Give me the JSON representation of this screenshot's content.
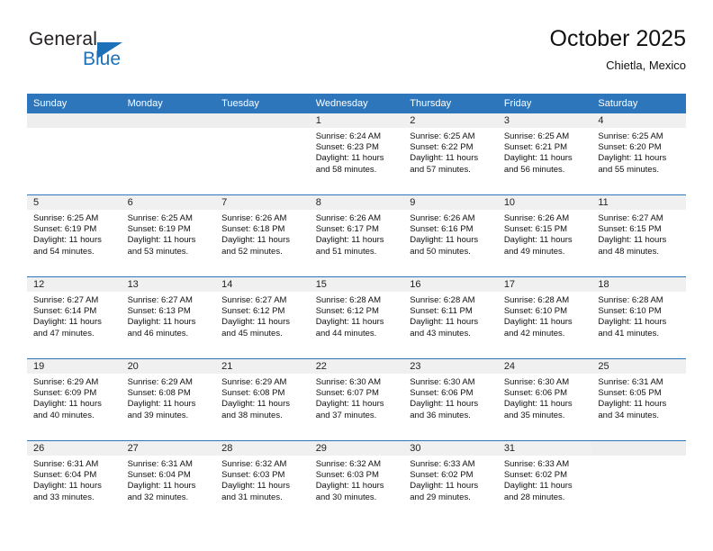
{
  "brand": {
    "name_top": "General",
    "name_bottom": "Blue",
    "triangle_color": "#1d71b8",
    "top_color": "#231f20",
    "bottom_color": "#1d71b8"
  },
  "header": {
    "title": "October 2025",
    "subtitle": "Chietla, Mexico"
  },
  "theme": {
    "header_bar": "#2e76bc",
    "daynum_band": "#eeeeee",
    "row_rule": "#2e76bc",
    "text": "#111111"
  },
  "weekday_headers": [
    "Sunday",
    "Monday",
    "Tuesday",
    "Wednesday",
    "Thursday",
    "Friday",
    "Saturday"
  ],
  "weeks": [
    [
      {
        "day": "",
        "lines": []
      },
      {
        "day": "",
        "lines": []
      },
      {
        "day": "",
        "lines": []
      },
      {
        "day": "1",
        "lines": [
          "Sunrise: 6:24 AM",
          "Sunset: 6:23 PM",
          "Daylight: 11 hours",
          "and 58 minutes."
        ]
      },
      {
        "day": "2",
        "lines": [
          "Sunrise: 6:25 AM",
          "Sunset: 6:22 PM",
          "Daylight: 11 hours",
          "and 57 minutes."
        ]
      },
      {
        "day": "3",
        "lines": [
          "Sunrise: 6:25 AM",
          "Sunset: 6:21 PM",
          "Daylight: 11 hours",
          "and 56 minutes."
        ]
      },
      {
        "day": "4",
        "lines": [
          "Sunrise: 6:25 AM",
          "Sunset: 6:20 PM",
          "Daylight: 11 hours",
          "and 55 minutes."
        ]
      }
    ],
    [
      {
        "day": "5",
        "lines": [
          "Sunrise: 6:25 AM",
          "Sunset: 6:19 PM",
          "Daylight: 11 hours",
          "and 54 minutes."
        ]
      },
      {
        "day": "6",
        "lines": [
          "Sunrise: 6:25 AM",
          "Sunset: 6:19 PM",
          "Daylight: 11 hours",
          "and 53 minutes."
        ]
      },
      {
        "day": "7",
        "lines": [
          "Sunrise: 6:26 AM",
          "Sunset: 6:18 PM",
          "Daylight: 11 hours",
          "and 52 minutes."
        ]
      },
      {
        "day": "8",
        "lines": [
          "Sunrise: 6:26 AM",
          "Sunset: 6:17 PM",
          "Daylight: 11 hours",
          "and 51 minutes."
        ]
      },
      {
        "day": "9",
        "lines": [
          "Sunrise: 6:26 AM",
          "Sunset: 6:16 PM",
          "Daylight: 11 hours",
          "and 50 minutes."
        ]
      },
      {
        "day": "10",
        "lines": [
          "Sunrise: 6:26 AM",
          "Sunset: 6:15 PM",
          "Daylight: 11 hours",
          "and 49 minutes."
        ]
      },
      {
        "day": "11",
        "lines": [
          "Sunrise: 6:27 AM",
          "Sunset: 6:15 PM",
          "Daylight: 11 hours",
          "and 48 minutes."
        ]
      }
    ],
    [
      {
        "day": "12",
        "lines": [
          "Sunrise: 6:27 AM",
          "Sunset: 6:14 PM",
          "Daylight: 11 hours",
          "and 47 minutes."
        ]
      },
      {
        "day": "13",
        "lines": [
          "Sunrise: 6:27 AM",
          "Sunset: 6:13 PM",
          "Daylight: 11 hours",
          "and 46 minutes."
        ]
      },
      {
        "day": "14",
        "lines": [
          "Sunrise: 6:27 AM",
          "Sunset: 6:12 PM",
          "Daylight: 11 hours",
          "and 45 minutes."
        ]
      },
      {
        "day": "15",
        "lines": [
          "Sunrise: 6:28 AM",
          "Sunset: 6:12 PM",
          "Daylight: 11 hours",
          "and 44 minutes."
        ]
      },
      {
        "day": "16",
        "lines": [
          "Sunrise: 6:28 AM",
          "Sunset: 6:11 PM",
          "Daylight: 11 hours",
          "and 43 minutes."
        ]
      },
      {
        "day": "17",
        "lines": [
          "Sunrise: 6:28 AM",
          "Sunset: 6:10 PM",
          "Daylight: 11 hours",
          "and 42 minutes."
        ]
      },
      {
        "day": "18",
        "lines": [
          "Sunrise: 6:28 AM",
          "Sunset: 6:10 PM",
          "Daylight: 11 hours",
          "and 41 minutes."
        ]
      }
    ],
    [
      {
        "day": "19",
        "lines": [
          "Sunrise: 6:29 AM",
          "Sunset: 6:09 PM",
          "Daylight: 11 hours",
          "and 40 minutes."
        ]
      },
      {
        "day": "20",
        "lines": [
          "Sunrise: 6:29 AM",
          "Sunset: 6:08 PM",
          "Daylight: 11 hours",
          "and 39 minutes."
        ]
      },
      {
        "day": "21",
        "lines": [
          "Sunrise: 6:29 AM",
          "Sunset: 6:08 PM",
          "Daylight: 11 hours",
          "and 38 minutes."
        ]
      },
      {
        "day": "22",
        "lines": [
          "Sunrise: 6:30 AM",
          "Sunset: 6:07 PM",
          "Daylight: 11 hours",
          "and 37 minutes."
        ]
      },
      {
        "day": "23",
        "lines": [
          "Sunrise: 6:30 AM",
          "Sunset: 6:06 PM",
          "Daylight: 11 hours",
          "and 36 minutes."
        ]
      },
      {
        "day": "24",
        "lines": [
          "Sunrise: 6:30 AM",
          "Sunset: 6:06 PM",
          "Daylight: 11 hours",
          "and 35 minutes."
        ]
      },
      {
        "day": "25",
        "lines": [
          "Sunrise: 6:31 AM",
          "Sunset: 6:05 PM",
          "Daylight: 11 hours",
          "and 34 minutes."
        ]
      }
    ],
    [
      {
        "day": "26",
        "lines": [
          "Sunrise: 6:31 AM",
          "Sunset: 6:04 PM",
          "Daylight: 11 hours",
          "and 33 minutes."
        ]
      },
      {
        "day": "27",
        "lines": [
          "Sunrise: 6:31 AM",
          "Sunset: 6:04 PM",
          "Daylight: 11 hours",
          "and 32 minutes."
        ]
      },
      {
        "day": "28",
        "lines": [
          "Sunrise: 6:32 AM",
          "Sunset: 6:03 PM",
          "Daylight: 11 hours",
          "and 31 minutes."
        ]
      },
      {
        "day": "29",
        "lines": [
          "Sunrise: 6:32 AM",
          "Sunset: 6:03 PM",
          "Daylight: 11 hours",
          "and 30 minutes."
        ]
      },
      {
        "day": "30",
        "lines": [
          "Sunrise: 6:33 AM",
          "Sunset: 6:02 PM",
          "Daylight: 11 hours",
          "and 29 minutes."
        ]
      },
      {
        "day": "31",
        "lines": [
          "Sunrise: 6:33 AM",
          "Sunset: 6:02 PM",
          "Daylight: 11 hours",
          "and 28 minutes."
        ]
      },
      {
        "day": "",
        "lines": []
      }
    ]
  ]
}
